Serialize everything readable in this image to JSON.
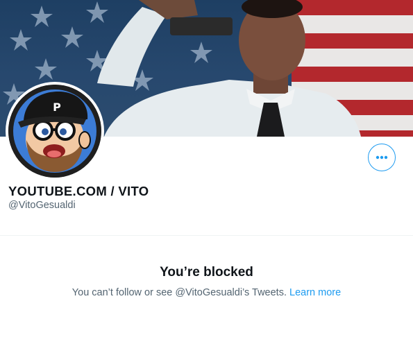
{
  "profile": {
    "display_name": "YOUTUBE.COM / VITO",
    "handle": "@VitoGesualdi"
  },
  "banner": {
    "subject": "man in white shirt and black tie holding a pistol in front of an American flag"
  },
  "avatar": {
    "subject": "cartoon bearded man with glasses and a black PlayStation cap"
  },
  "actions": {
    "more_icon": "more-horizontal-icon"
  },
  "blocked": {
    "title": "You’re blocked",
    "message": "You can’t follow or see @VitoGesualdi’s Tweets.",
    "link": "Learn more"
  },
  "colors": {
    "accent": "#1d9bf0",
    "text_primary": "#0f1419",
    "text_secondary": "#536471",
    "divider": "#eff3f4"
  }
}
